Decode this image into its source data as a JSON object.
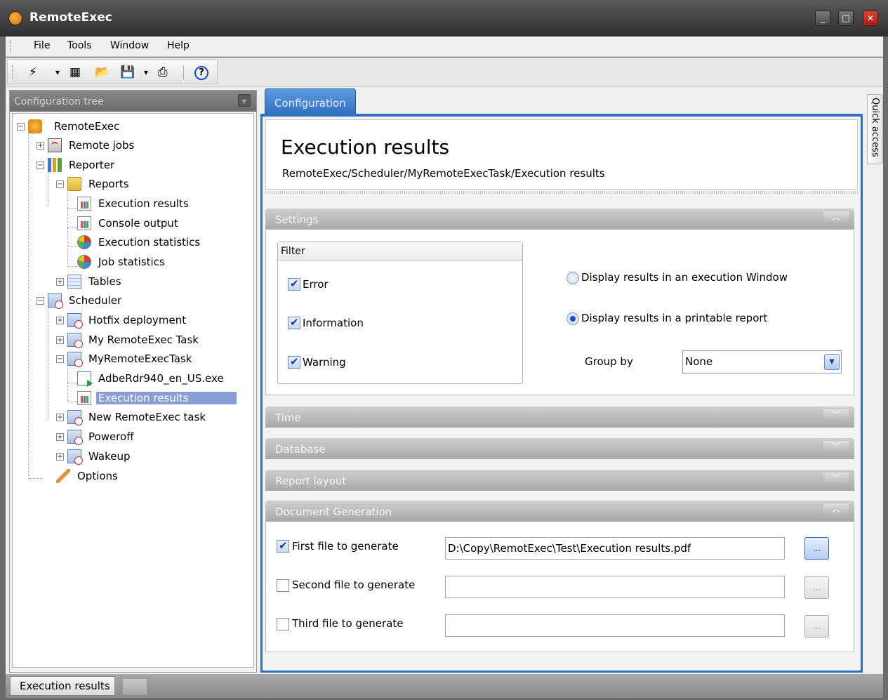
{
  "window": {
    "title": "RemoteExec",
    "minimize": "_",
    "maximize": "□",
    "close": "✕"
  },
  "menu": [
    {
      "label": "File",
      "name": "menu-file"
    },
    {
      "label": "Tools",
      "name": "menu-tools"
    },
    {
      "label": "Window",
      "name": "menu-window"
    },
    {
      "label": "Help",
      "name": "menu-help"
    }
  ],
  "toolbar": {
    "items": [
      {
        "name": "execute-icon",
        "glyph": "⚡",
        "color": "#e8a020"
      },
      {
        "name": "dropdown-arrow-icon",
        "glyph": "▾",
        "color": "#333"
      },
      {
        "name": "schedule-icon",
        "glyph": "▦",
        "color": "#3a6ab8"
      },
      {
        "name": "open-folder-icon",
        "glyph": "📂",
        "color": "#d8a020"
      },
      {
        "name": "save-icon",
        "glyph": "💾",
        "color": "#3a6ab8"
      },
      {
        "name": "save-dropdown-arrow-icon",
        "glyph": "▾",
        "color": "#333"
      },
      {
        "name": "print-icon",
        "glyph": "⎙",
        "color": "#aaa"
      },
      {
        "name": "help-icon",
        "glyph": "?",
        "color": "#1a4ad0"
      }
    ]
  },
  "tree": {
    "header": "Configuration tree",
    "pin": "ᚁ",
    "nodes": [
      {
        "label": "RemoteExec",
        "icon": "ic-root",
        "name": "tree-node-remoteexec",
        "expander": "−"
      },
      {
        "label": "Remote jobs",
        "icon": "ic-remote",
        "name": "tree-node-remote-jobs",
        "expander": "+"
      },
      {
        "label": "Reporter",
        "icon": "ic-reporter",
        "name": "tree-node-reporter",
        "expander": "−"
      },
      {
        "label": "Reports",
        "icon": "ic-folder",
        "name": "tree-node-reports",
        "expander": "−"
      },
      {
        "label": "Execution results",
        "icon": "ic-chart",
        "name": "tree-node-execution-results-report"
      },
      {
        "label": "Console output",
        "icon": "ic-chart",
        "name": "tree-node-console-output"
      },
      {
        "label": "Execution statistics",
        "icon": "ic-pie",
        "name": "tree-node-execution-statistics"
      },
      {
        "label": "Job statistics",
        "icon": "ic-pie",
        "name": "tree-node-job-statistics"
      },
      {
        "label": "Tables",
        "icon": "ic-table",
        "name": "tree-node-tables",
        "expander": "+"
      },
      {
        "label": "Scheduler",
        "icon": "ic-sched",
        "name": "tree-node-scheduler",
        "expander": "−"
      },
      {
        "label": "Hotfix deployment",
        "icon": "ic-sched",
        "name": "tree-node-hotfix-deployment",
        "expander": "+"
      },
      {
        "label": "My RemoteExec Task",
        "icon": "ic-sched",
        "name": "tree-node-my-remoteexec-task",
        "expander": "+"
      },
      {
        "label": "MyRemoteExecTask",
        "icon": "ic-sched",
        "name": "tree-node-myremoteexectask",
        "expander": "−"
      },
      {
        "label": "AdbeRdr940_en_US.exe",
        "icon": "ic-exe",
        "name": "tree-node-adberdr940"
      },
      {
        "label": "Execution results",
        "icon": "ic-chart",
        "name": "tree-node-execution-results-selected"
      },
      {
        "label": "New RemoteExec task",
        "icon": "ic-sched",
        "name": "tree-node-new-remoteexec-task",
        "expander": "+"
      },
      {
        "label": "Poweroff",
        "icon": "ic-sched",
        "name": "tree-node-poweroff",
        "expander": "+"
      },
      {
        "label": "Wakeup",
        "icon": "ic-sched",
        "name": "tree-node-wakeup",
        "expander": "+"
      },
      {
        "label": "Options",
        "icon": "ic-options",
        "name": "tree-node-options"
      }
    ]
  },
  "tabs": [
    {
      "label": "Configuration"
    }
  ],
  "page": {
    "title": "Execution results",
    "breadcrumb": "RemoteExec/Scheduler/MyRemoteExecTask/Execution results"
  },
  "sections": {
    "settings": {
      "label": "Settings",
      "chevron": "︿"
    },
    "time": {
      "label": "Time",
      "chevron": "﹀"
    },
    "database": {
      "label": "Database",
      "chevron": "﹀"
    },
    "report_layout": {
      "label": "Report layout",
      "chevron": "﹀"
    },
    "document_generation": {
      "label": "Document Generation",
      "chevron": "︿"
    }
  },
  "filter": {
    "title": "Filter",
    "items": [
      {
        "label": "Error",
        "checked": true
      },
      {
        "label": "Information",
        "checked": true
      },
      {
        "label": "Warning",
        "checked": true
      }
    ]
  },
  "display": {
    "options": [
      {
        "label": "Display results in an execution Window",
        "selected": false
      },
      {
        "label": "Display results in a printable report",
        "selected": true
      }
    ],
    "group_by_label": "Group by",
    "group_by_value": "None",
    "dropdown_glyph": "▼"
  },
  "documents": [
    {
      "label": "First file to generate",
      "checked": true,
      "path": "D:\\Copy\\RemotExec\\Test\\Execution results.pdf",
      "browse": "..."
    },
    {
      "label": "Second file to generate",
      "checked": false,
      "path": "",
      "browse": "..."
    },
    {
      "label": "Third file to generate",
      "checked": false,
      "path": "",
      "browse": "..."
    }
  ],
  "quick_access": "Quick access",
  "status": {
    "text": "Execution results"
  }
}
